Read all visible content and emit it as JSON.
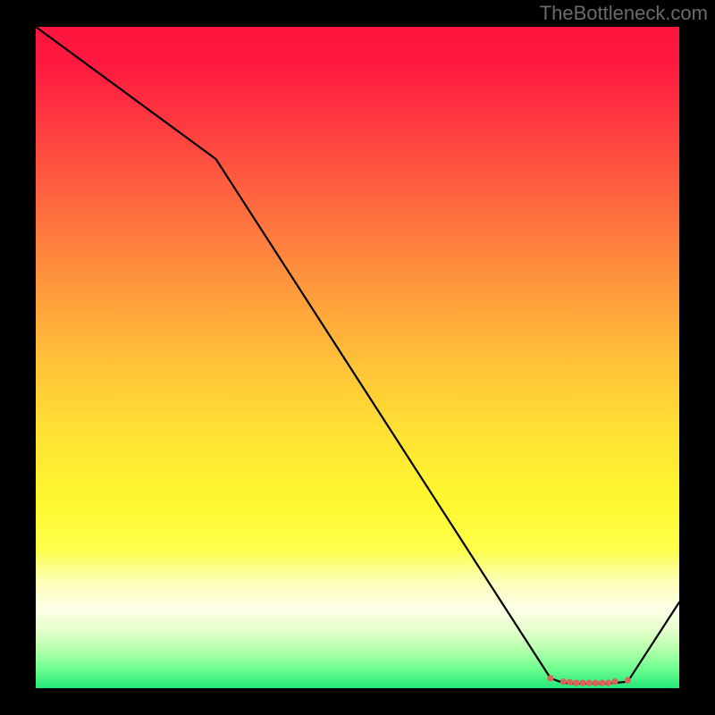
{
  "watermark": "TheBottleneck.com",
  "chart_data": {
    "type": "line",
    "title": "",
    "xlabel": "",
    "ylabel": "",
    "xlim": [
      0,
      100
    ],
    "ylim": [
      0,
      100
    ],
    "grid": false,
    "legend": false,
    "series": [
      {
        "name": "curve",
        "x": [
          0,
          28,
          80,
          82,
          84,
          86,
          88,
          90,
          92,
          100
        ],
        "y": [
          100,
          80,
          1.5,
          0.8,
          0.7,
          0.7,
          0.7,
          0.8,
          1.0,
          13
        ]
      }
    ],
    "markers": {
      "x": [
        80,
        82,
        83,
        84,
        85,
        86,
        87,
        88,
        89,
        90,
        92
      ],
      "y": [
        1.5,
        1.0,
        0.9,
        0.8,
        0.8,
        0.8,
        0.8,
        0.8,
        0.8,
        1.0,
        1.2
      ],
      "color": "#d9645a"
    },
    "annotations": []
  },
  "colors": {
    "curve_stroke": "#000000",
    "marker_fill": "#d9645a",
    "watermark": "#6b6b6b"
  }
}
